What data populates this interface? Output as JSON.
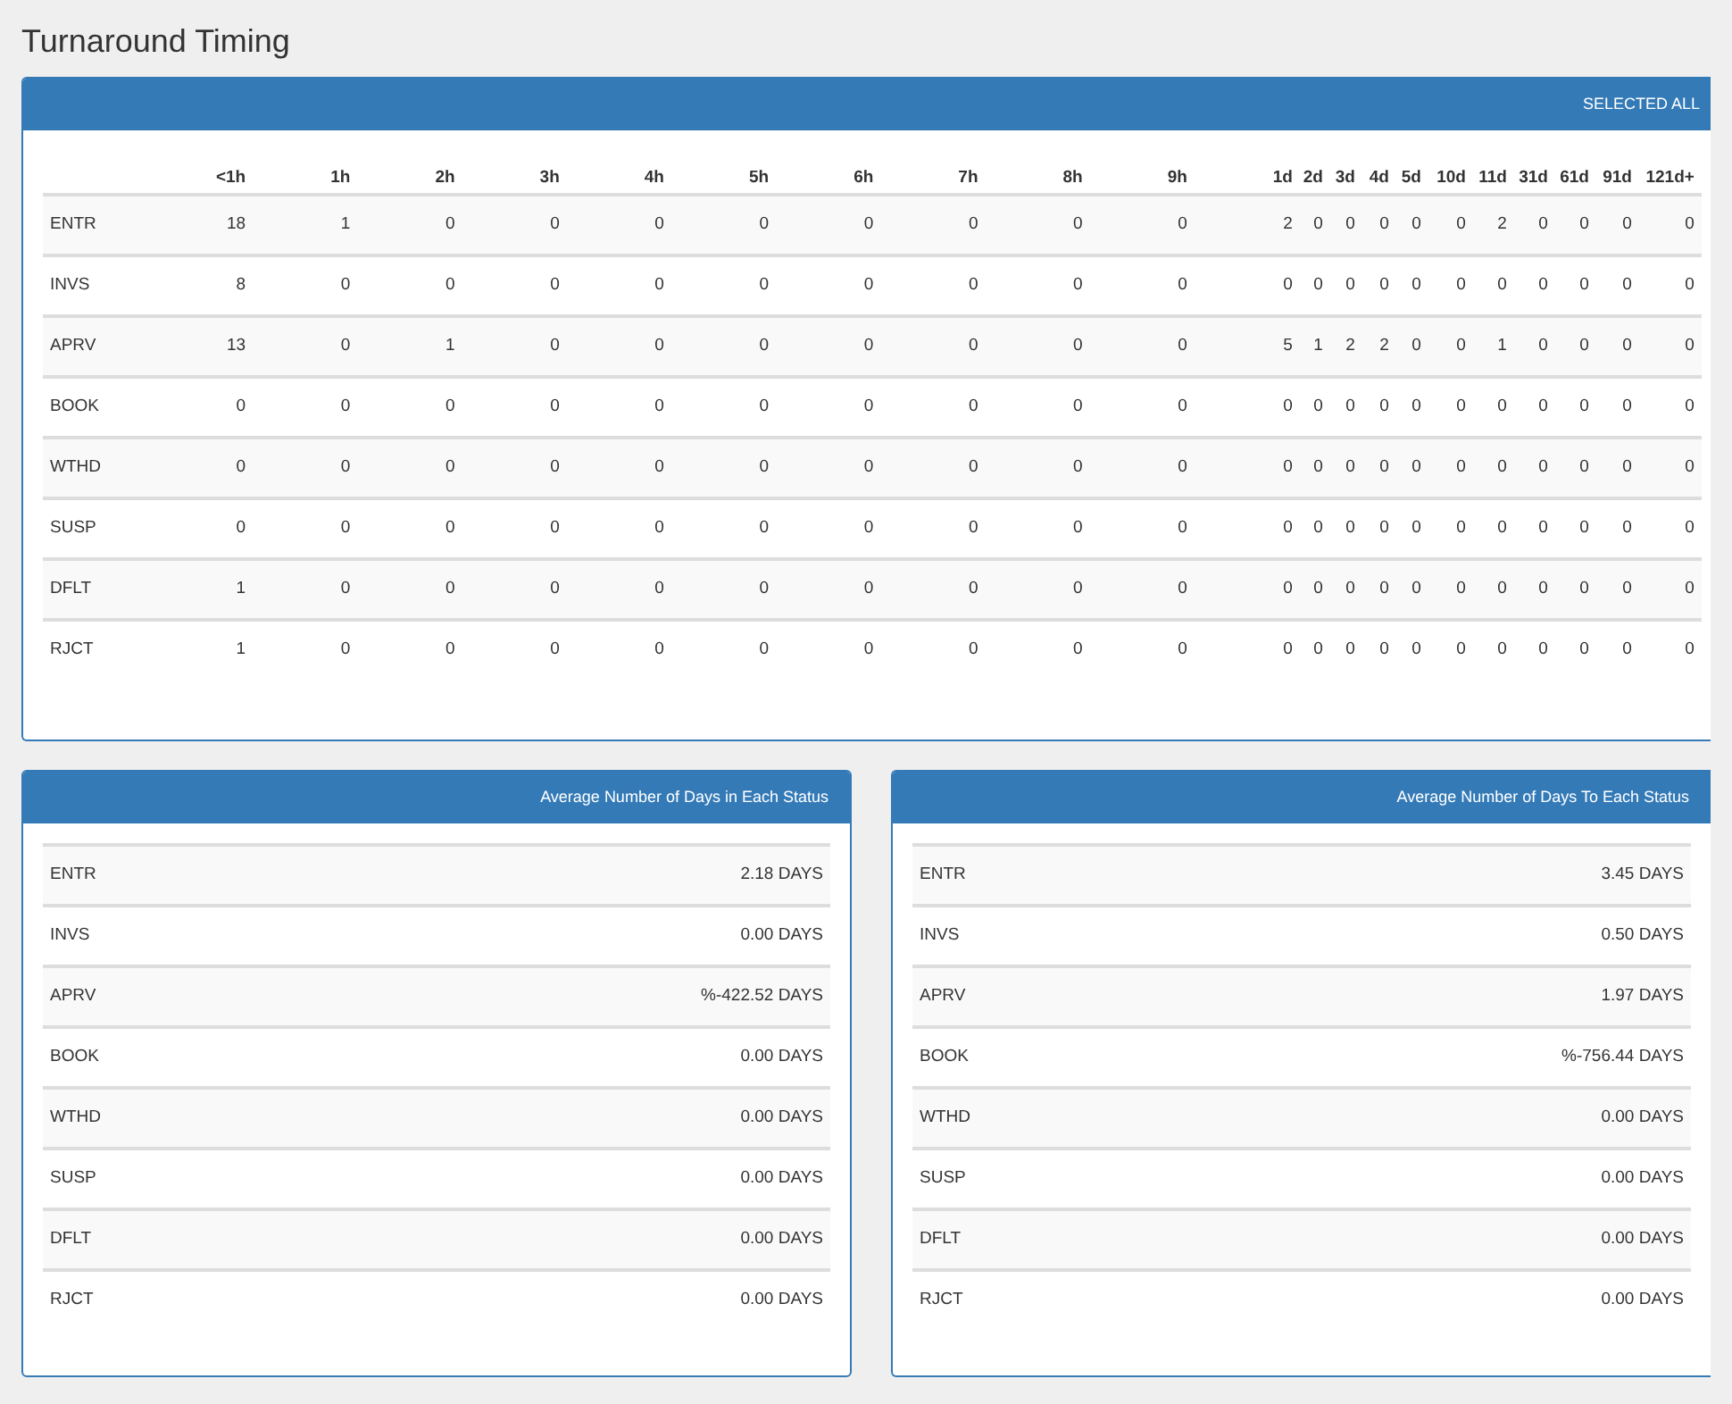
{
  "title": "Turnaround Timing",
  "timing_panel": {
    "header_label": "SELECTED ALL",
    "table": {
      "columns": [
        "<1h",
        "1h",
        "2h",
        "3h",
        "4h",
        "5h",
        "6h",
        "7h",
        "8h",
        "9h",
        "1d",
        "2d",
        "3d",
        "4d",
        "5d",
        "10d",
        "11d",
        "31d",
        "61d",
        "91d",
        "121d+"
      ],
      "rows": [
        {
          "status": "ENTR",
          "cells": [
            "18",
            "1",
            "0",
            "0",
            "0",
            "0",
            "0",
            "0",
            "0",
            "0",
            "2",
            "0",
            "0",
            "0",
            "0",
            "0",
            "2",
            "0",
            "0",
            "0",
            "0"
          ]
        },
        {
          "status": "INVS",
          "cells": [
            "8",
            "0",
            "0",
            "0",
            "0",
            "0",
            "0",
            "0",
            "0",
            "0",
            "0",
            "0",
            "0",
            "0",
            "0",
            "0",
            "0",
            "0",
            "0",
            "0",
            "0"
          ]
        },
        {
          "status": "APRV",
          "cells": [
            "13",
            "0",
            "1",
            "0",
            "0",
            "0",
            "0",
            "0",
            "0",
            "0",
            "5",
            "1",
            "2",
            "2",
            "0",
            "0",
            "1",
            "0",
            "0",
            "0",
            "0"
          ]
        },
        {
          "status": "BOOK",
          "cells": [
            "0",
            "0",
            "0",
            "0",
            "0",
            "0",
            "0",
            "0",
            "0",
            "0",
            "0",
            "0",
            "0",
            "0",
            "0",
            "0",
            "0",
            "0",
            "0",
            "0",
            "0"
          ]
        },
        {
          "status": "WTHD",
          "cells": [
            "0",
            "0",
            "0",
            "0",
            "0",
            "0",
            "0",
            "0",
            "0",
            "0",
            "0",
            "0",
            "0",
            "0",
            "0",
            "0",
            "0",
            "0",
            "0",
            "0",
            "0"
          ]
        },
        {
          "status": "SUSP",
          "cells": [
            "0",
            "0",
            "0",
            "0",
            "0",
            "0",
            "0",
            "0",
            "0",
            "0",
            "0",
            "0",
            "0",
            "0",
            "0",
            "0",
            "0",
            "0",
            "0",
            "0",
            "0"
          ]
        },
        {
          "status": "DFLT",
          "cells": [
            "1",
            "0",
            "0",
            "0",
            "0",
            "0",
            "0",
            "0",
            "0",
            "0",
            "0",
            "0",
            "0",
            "0",
            "0",
            "0",
            "0",
            "0",
            "0",
            "0",
            "0"
          ]
        },
        {
          "status": "RJCT",
          "cells": [
            "1",
            "0",
            "0",
            "0",
            "0",
            "0",
            "0",
            "0",
            "0",
            "0",
            "0",
            "0",
            "0",
            "0",
            "0",
            "0",
            "0",
            "0",
            "0",
            "0",
            "0"
          ]
        }
      ]
    }
  },
  "average_panels": [
    {
      "title": "Average Number of Days in Each Status",
      "rows": [
        {
          "status": "ENTR",
          "value": "2.18 DAYS"
        },
        {
          "status": "INVS",
          "value": "0.00 DAYS"
        },
        {
          "status": "APRV",
          "value": "%-422.52 DAYS"
        },
        {
          "status": "BOOK",
          "value": "0.00 DAYS"
        },
        {
          "status": "WTHD",
          "value": "0.00 DAYS"
        },
        {
          "status": "SUSP",
          "value": "0.00 DAYS"
        },
        {
          "status": "DFLT",
          "value": "0.00 DAYS"
        },
        {
          "status": "RJCT",
          "value": "0.00 DAYS"
        }
      ]
    },
    {
      "title": "Average Number of Days To Each Status",
      "rows": [
        {
          "status": "ENTR",
          "value": "3.45 DAYS"
        },
        {
          "status": "INVS",
          "value": "0.50 DAYS"
        },
        {
          "status": "APRV",
          "value": "1.97 DAYS"
        },
        {
          "status": "BOOK",
          "value": "%-756.44 DAYS"
        },
        {
          "status": "WTHD",
          "value": "0.00 DAYS"
        },
        {
          "status": "SUSP",
          "value": "0.00 DAYS"
        },
        {
          "status": "DFLT",
          "value": "0.00 DAYS"
        },
        {
          "status": "RJCT",
          "value": "0.00 DAYS"
        }
      ]
    }
  ]
}
